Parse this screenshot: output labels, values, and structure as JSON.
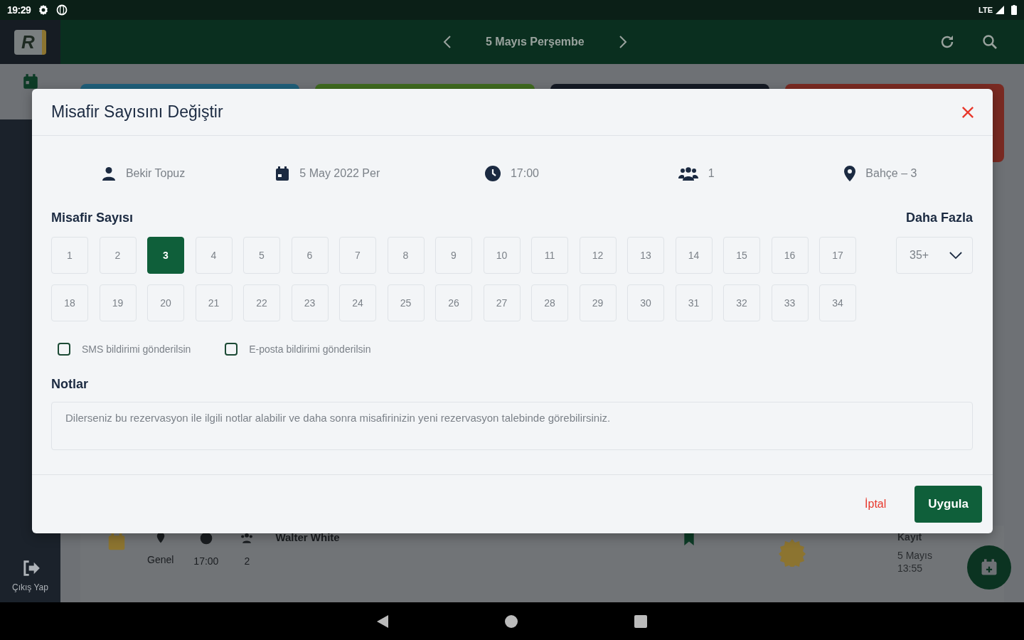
{
  "status_bar": {
    "time": "19:29",
    "network": "LTE"
  },
  "app_bar": {
    "logo": "R",
    "title": "5 Mayıs Perşembe"
  },
  "sidebar": {
    "items": [
      {
        "kind": "calendar"
      },
      {
        "kind": "logout",
        "label": "Çıkış Yap"
      }
    ]
  },
  "background": {
    "cards": [
      {
        "color": "#1f5f7a"
      },
      {
        "color": "#3f6a1f"
      },
      {
        "color": "#141a24"
      },
      {
        "color": "#7a2a22"
      }
    ],
    "reservation": {
      "area": "Genel",
      "time": "17:00",
      "guests": "2",
      "name": "Walter White",
      "record_label": "Kayıt",
      "record_date": "5 Mayıs",
      "record_time": "13:55"
    }
  },
  "dialog": {
    "title": "Misafir Sayısını Değiştir",
    "info": [
      {
        "kind": "person",
        "text": "Bekir Topuz"
      },
      {
        "kind": "calendar",
        "text": "5 May 2022 Per"
      },
      {
        "kind": "clock",
        "text": "17:00"
      },
      {
        "kind": "people",
        "text": "1"
      },
      {
        "kind": "pin",
        "text": "Bahçe – 3"
      }
    ],
    "guest_label": "Misafir Sayısı",
    "guest_counts": [
      {
        "label": "1",
        "selected": false
      },
      {
        "label": "2",
        "selected": false
      },
      {
        "label": "3",
        "selected": true
      },
      {
        "label": "4",
        "selected": false
      },
      {
        "label": "5",
        "selected": false
      },
      {
        "label": "6",
        "selected": false
      },
      {
        "label": "7",
        "selected": false
      },
      {
        "label": "8",
        "selected": false
      },
      {
        "label": "9",
        "selected": false
      },
      {
        "label": "10",
        "selected": false
      },
      {
        "label": "11",
        "selected": false
      },
      {
        "label": "12",
        "selected": false
      },
      {
        "label": "13",
        "selected": false
      },
      {
        "label": "14",
        "selected": false
      },
      {
        "label": "15",
        "selected": false
      },
      {
        "label": "16",
        "selected": false
      },
      {
        "label": "17",
        "selected": false
      },
      {
        "label": "18",
        "selected": false
      },
      {
        "label": "19",
        "selected": false
      },
      {
        "label": "20",
        "selected": false
      },
      {
        "label": "21",
        "selected": false
      },
      {
        "label": "22",
        "selected": false
      },
      {
        "label": "23",
        "selected": false
      },
      {
        "label": "24",
        "selected": false
      },
      {
        "label": "25",
        "selected": false
      },
      {
        "label": "26",
        "selected": false
      },
      {
        "label": "27",
        "selected": false
      },
      {
        "label": "28",
        "selected": false
      },
      {
        "label": "29",
        "selected": false
      },
      {
        "label": "30",
        "selected": false
      },
      {
        "label": "31",
        "selected": false
      },
      {
        "label": "32",
        "selected": false
      },
      {
        "label": "33",
        "selected": false
      },
      {
        "label": "34",
        "selected": false
      }
    ],
    "more_label": "Daha Fazla",
    "more_value": "35+",
    "notifications": [
      {
        "label": "SMS bildirimi gönderilsin",
        "checked": false
      },
      {
        "label": "E-posta bildirimi gönderilsin",
        "checked": false
      }
    ],
    "notes_label": "Notlar",
    "notes_placeholder": "Dilerseniz bu rezervasyon ile ilgili notlar alabilir ve daha sonra misafirinizin yeni rezervasyon talebinde görebilirsiniz.",
    "buttons": [
      {
        "kind": "text",
        "label": "İptal"
      },
      {
        "kind": "primary",
        "label": "Uygula"
      }
    ]
  }
}
